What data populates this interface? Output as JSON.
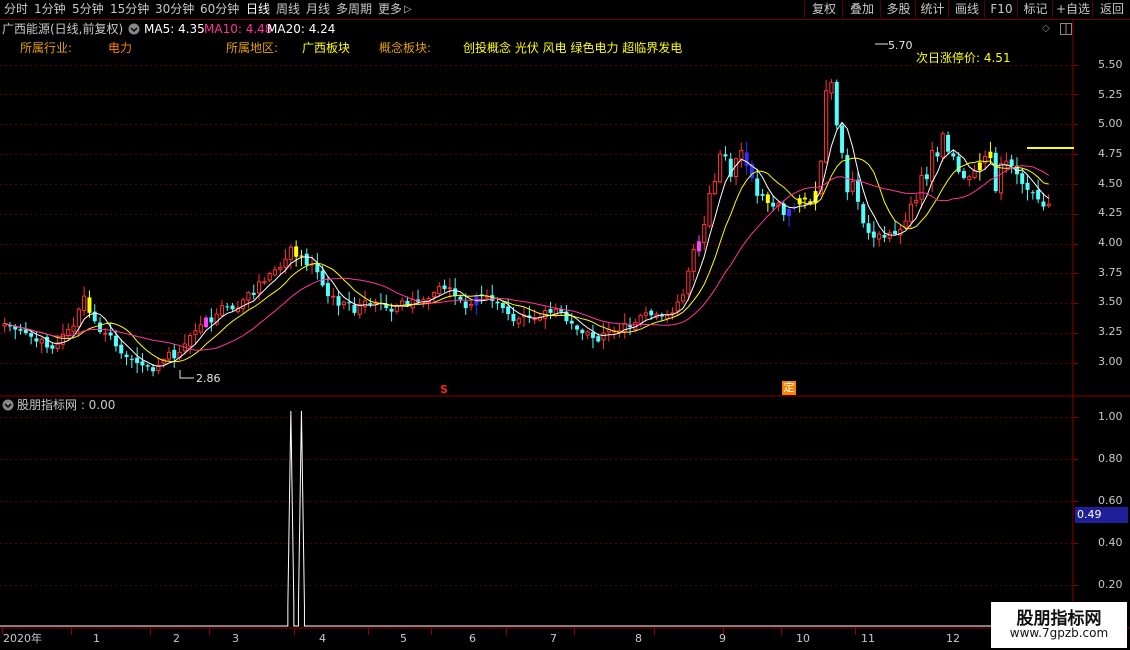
{
  "toolbar": {
    "periods": [
      "分时",
      "1分钟",
      "5分钟",
      "15分钟",
      "30分钟",
      "60分钟",
      "日线",
      "周线",
      "月线",
      "多周期",
      "更多"
    ],
    "active_period": "日线",
    "more_arrow": "▷",
    "right_buttons": [
      "复权",
      "叠加",
      "多股",
      "统计",
      "画线",
      "F10",
      "标记",
      "+自选",
      "返回"
    ]
  },
  "header": {
    "stock_title": "广西能源(日线,前复权)",
    "ma5_label": "MA5: 4.35",
    "ma10_label": "MA10: 4.48",
    "ma20_label": "MA20: 4.24",
    "colors": {
      "ma5": "#ffffff",
      "ma10": "#ffff00",
      "ma20": "#ff00ff"
    }
  },
  "info_row": {
    "industry_label": "所属行业:",
    "industry_value": "电力",
    "region_label": "所属地区:",
    "region_value": "广西板块",
    "concept_label": "概念板块:",
    "concept_value": "创投概念 光伏 风电 绿色电力 超临界发电"
  },
  "annotations": {
    "high_mark": "5.70",
    "low_mark": "2.86",
    "limit_up_label": "次日涨停价: 4.51",
    "marker_s": "S",
    "marker_ding": "定"
  },
  "price_axis": [
    "5.50",
    "5.25",
    "5.00",
    "4.75",
    "4.50",
    "4.25",
    "4.00",
    "3.75",
    "3.50",
    "3.25",
    "3.00"
  ],
  "indicator": {
    "title": "股朋指标网 : 0.00",
    "axis": [
      "1.00",
      "0.80",
      "0.60",
      "0.40",
      "0.20"
    ],
    "current_value": "0.49"
  },
  "x_axis": [
    "2020年",
    "1",
    "2",
    "3",
    "4",
    "5",
    "6",
    "7",
    "8",
    "9",
    "10",
    "11",
    "12"
  ],
  "watermark": {
    "line1": "股朋指标网",
    "line2": "www.7gpzb.com"
  },
  "chart_data": {
    "type": "candlestick",
    "ylim": [
      2.85,
      5.72
    ],
    "indicator_ylim": [
      0,
      1.05
    ],
    "month_starts": {
      "1": 13,
      "2": 28,
      "3": 39,
      "4": 55,
      "5": 69,
      "6": 81,
      "7": 95,
      "8": 108,
      "9": 123,
      "10": 136,
      "11": 147,
      "12": 161
    },
    "close": [
      3.33,
      3.31,
      3.28,
      3.27,
      3.25,
      3.22,
      3.18,
      3.2,
      3.13,
      3.12,
      3.17,
      3.24,
      3.28,
      3.31,
      3.45,
      3.56,
      3.42,
      3.35,
      3.26,
      3.25,
      3.23,
      3.14,
      3.08,
      3.05,
      3.03,
      3.0,
      2.98,
      2.97,
      2.93,
      2.98,
      3.03,
      3.09,
      3.04,
      3.09,
      3.16,
      3.23,
      3.27,
      3.32,
      3.38,
      3.34,
      3.41,
      3.48,
      3.47,
      3.45,
      3.46,
      3.53,
      3.59,
      3.57,
      3.68,
      3.68,
      3.75,
      3.78,
      3.8,
      3.87,
      3.97,
      3.89,
      3.9,
      3.82,
      3.83,
      3.76,
      3.65,
      3.56,
      3.56,
      3.48,
      3.51,
      3.5,
      3.42,
      3.49,
      3.52,
      3.49,
      3.51,
      3.5,
      3.46,
      3.43,
      3.48,
      3.52,
      3.48,
      3.53,
      3.51,
      3.53,
      3.54,
      3.59,
      3.64,
      3.62,
      3.63,
      3.56,
      3.53,
      3.46,
      3.49,
      3.57,
      3.56,
      3.56,
      3.52,
      3.5,
      3.46,
      3.41,
      3.35,
      3.37,
      3.4,
      3.38,
      3.37,
      3.38,
      3.44,
      3.42,
      3.45,
      3.43,
      3.35,
      3.33,
      3.28,
      3.25,
      3.26,
      3.21,
      3.18,
      3.25,
      3.28,
      3.27,
      3.27,
      3.33,
      3.3,
      3.34,
      3.4,
      3.42,
      3.4,
      3.41,
      3.39,
      3.4,
      3.42,
      3.51,
      3.57,
      3.77,
      3.95,
      4.02,
      4.16,
      4.42,
      4.52,
      4.75,
      4.73,
      4.56,
      4.71,
      4.78,
      4.65,
      4.55,
      4.4,
      4.4,
      4.34,
      4.31,
      4.34,
      4.24,
      4.29,
      4.31,
      4.38,
      4.37,
      4.33,
      4.44,
      4.69,
      5.28,
      5.35,
      4.99,
      4.76,
      4.43,
      4.52,
      4.35,
      4.17,
      4.09,
      4.05,
      4.08,
      4.05,
      4.09,
      4.08,
      4.12,
      4.19,
      4.33,
      4.36,
      4.57,
      4.54,
      4.78,
      4.73,
      4.92,
      4.77,
      4.73,
      4.6,
      4.55,
      4.56,
      4.61,
      4.68,
      4.73,
      4.77,
      4.44,
      4.67,
      4.69,
      4.65,
      4.58,
      4.5,
      4.45,
      4.43,
      4.37,
      4.31,
      4.33
    ],
    "indicator_spikes": [
      {
        "index": 54,
        "value": 1
      },
      {
        "index": 56,
        "value": 1
      }
    ]
  }
}
